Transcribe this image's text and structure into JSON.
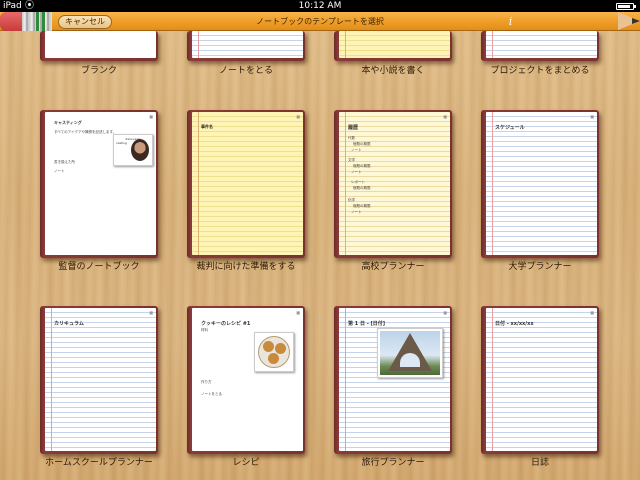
{
  "status_bar": {
    "device": "iPad",
    "time": "10:12 AM"
  },
  "toolbar": {
    "cancel_label": "キャンセル",
    "title": "ノートブックのテンプレートを選択"
  },
  "templates": [
    {
      "label": "ブランク"
    },
    {
      "label": "ノートをとる"
    },
    {
      "label": "本や小説を書く"
    },
    {
      "label": "プロジェクトをまとめる"
    },
    {
      "label": "監督のノートブック",
      "page": {
        "heading": "キャスティング",
        "line1": "すべてのアイデアや構想を記述します。",
        "photo_caption1": "dans.jaala",
        "photo_caption2": "casting",
        "line2": "書き換えた所",
        "line3": "ノート"
      }
    },
    {
      "label": "裁判に向けた準備をする",
      "page": {
        "heading": "事件名"
      }
    },
    {
      "label": "高校プランナー",
      "page": {
        "heading": "履歴",
        "items": [
          "代数",
          "宿題の期限",
          "ノート",
          "文学",
          "宿題の期限",
          "ノート",
          "レポート",
          "宿題の期限",
          "化学",
          "宿題の期限",
          "ノート"
        ]
      }
    },
    {
      "label": "大学プランナー",
      "page": {
        "heading": "スケジュール"
      }
    },
    {
      "label": "ホームスクールプランナー",
      "page": {
        "heading": "カリキュラム"
      }
    },
    {
      "label": "レシピ",
      "page": {
        "heading": "クッキーのレシピ #1",
        "line1": "材料",
        "line2": "作り方",
        "line3": "ノートをとる"
      }
    },
    {
      "label": "旅行プランナー",
      "page": {
        "heading": "第 1 日 - [日付]"
      }
    },
    {
      "label": "日誌",
      "page": {
        "heading": "日付 - xx/xx/xx"
      }
    }
  ]
}
